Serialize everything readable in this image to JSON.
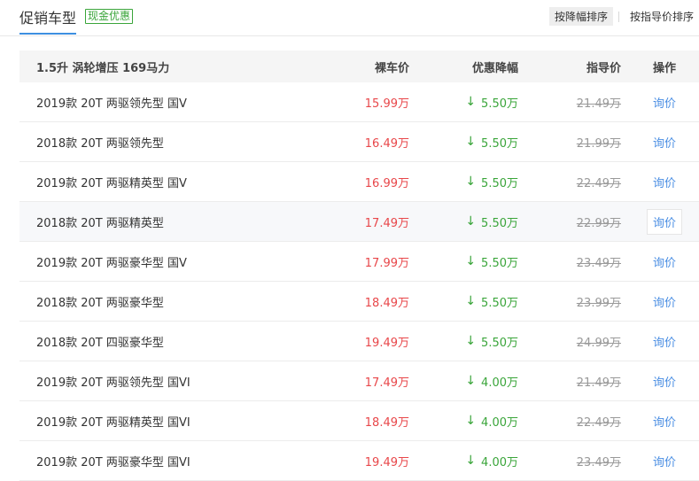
{
  "header": {
    "title": "促销车型",
    "badge": "现金优惠",
    "sort_by_discount": "按降幅排序",
    "sort_by_msrp": "按指导价排序"
  },
  "table": {
    "group_label": "1.5升 涡轮增压 169马力",
    "columns": {
      "price": "裸车价",
      "discount": "优惠降幅",
      "msrp": "指导价",
      "action": "操作"
    },
    "rows": [
      {
        "name": "2019款 20T 两驱领先型 国V",
        "price": "15.99万",
        "discount": "5.50万",
        "msrp": "21.49万",
        "action": "询价"
      },
      {
        "name": "2018款 20T 两驱领先型",
        "price": "16.49万",
        "discount": "5.50万",
        "msrp": "21.99万",
        "action": "询价"
      },
      {
        "name": "2019款 20T 两驱精英型 国V",
        "price": "16.99万",
        "discount": "5.50万",
        "msrp": "22.49万",
        "action": "询价"
      },
      {
        "name": "2018款 20T 两驱精英型",
        "price": "17.49万",
        "discount": "5.50万",
        "msrp": "22.99万",
        "action": "询价"
      },
      {
        "name": "2019款 20T 两驱豪华型 国V",
        "price": "17.99万",
        "discount": "5.50万",
        "msrp": "23.49万",
        "action": "询价"
      },
      {
        "name": "2018款 20T 两驱豪华型",
        "price": "18.49万",
        "discount": "5.50万",
        "msrp": "23.99万",
        "action": "询价"
      },
      {
        "name": "2018款 20T 四驱豪华型",
        "price": "19.49万",
        "discount": "5.50万",
        "msrp": "24.99万",
        "action": "询价"
      },
      {
        "name": "2019款 20T 两驱领先型 国VI",
        "price": "17.49万",
        "discount": "4.00万",
        "msrp": "21.49万",
        "action": "询价"
      },
      {
        "name": "2019款 20T 两驱精英型 国VI",
        "price": "18.49万",
        "discount": "4.00万",
        "msrp": "22.49万",
        "action": "询价"
      },
      {
        "name": "2019款 20T 两驱豪华型 国VI",
        "price": "19.49万",
        "discount": "4.00万",
        "msrp": "23.49万",
        "action": "询价"
      }
    ]
  },
  "icons": {
    "discount_arrow": "arrow-down-icon"
  },
  "colors": {
    "price": "#e8474a",
    "discount": "#3aa53a",
    "link": "#4a8ee3",
    "tab_underline": "#3d8fe0"
  }
}
